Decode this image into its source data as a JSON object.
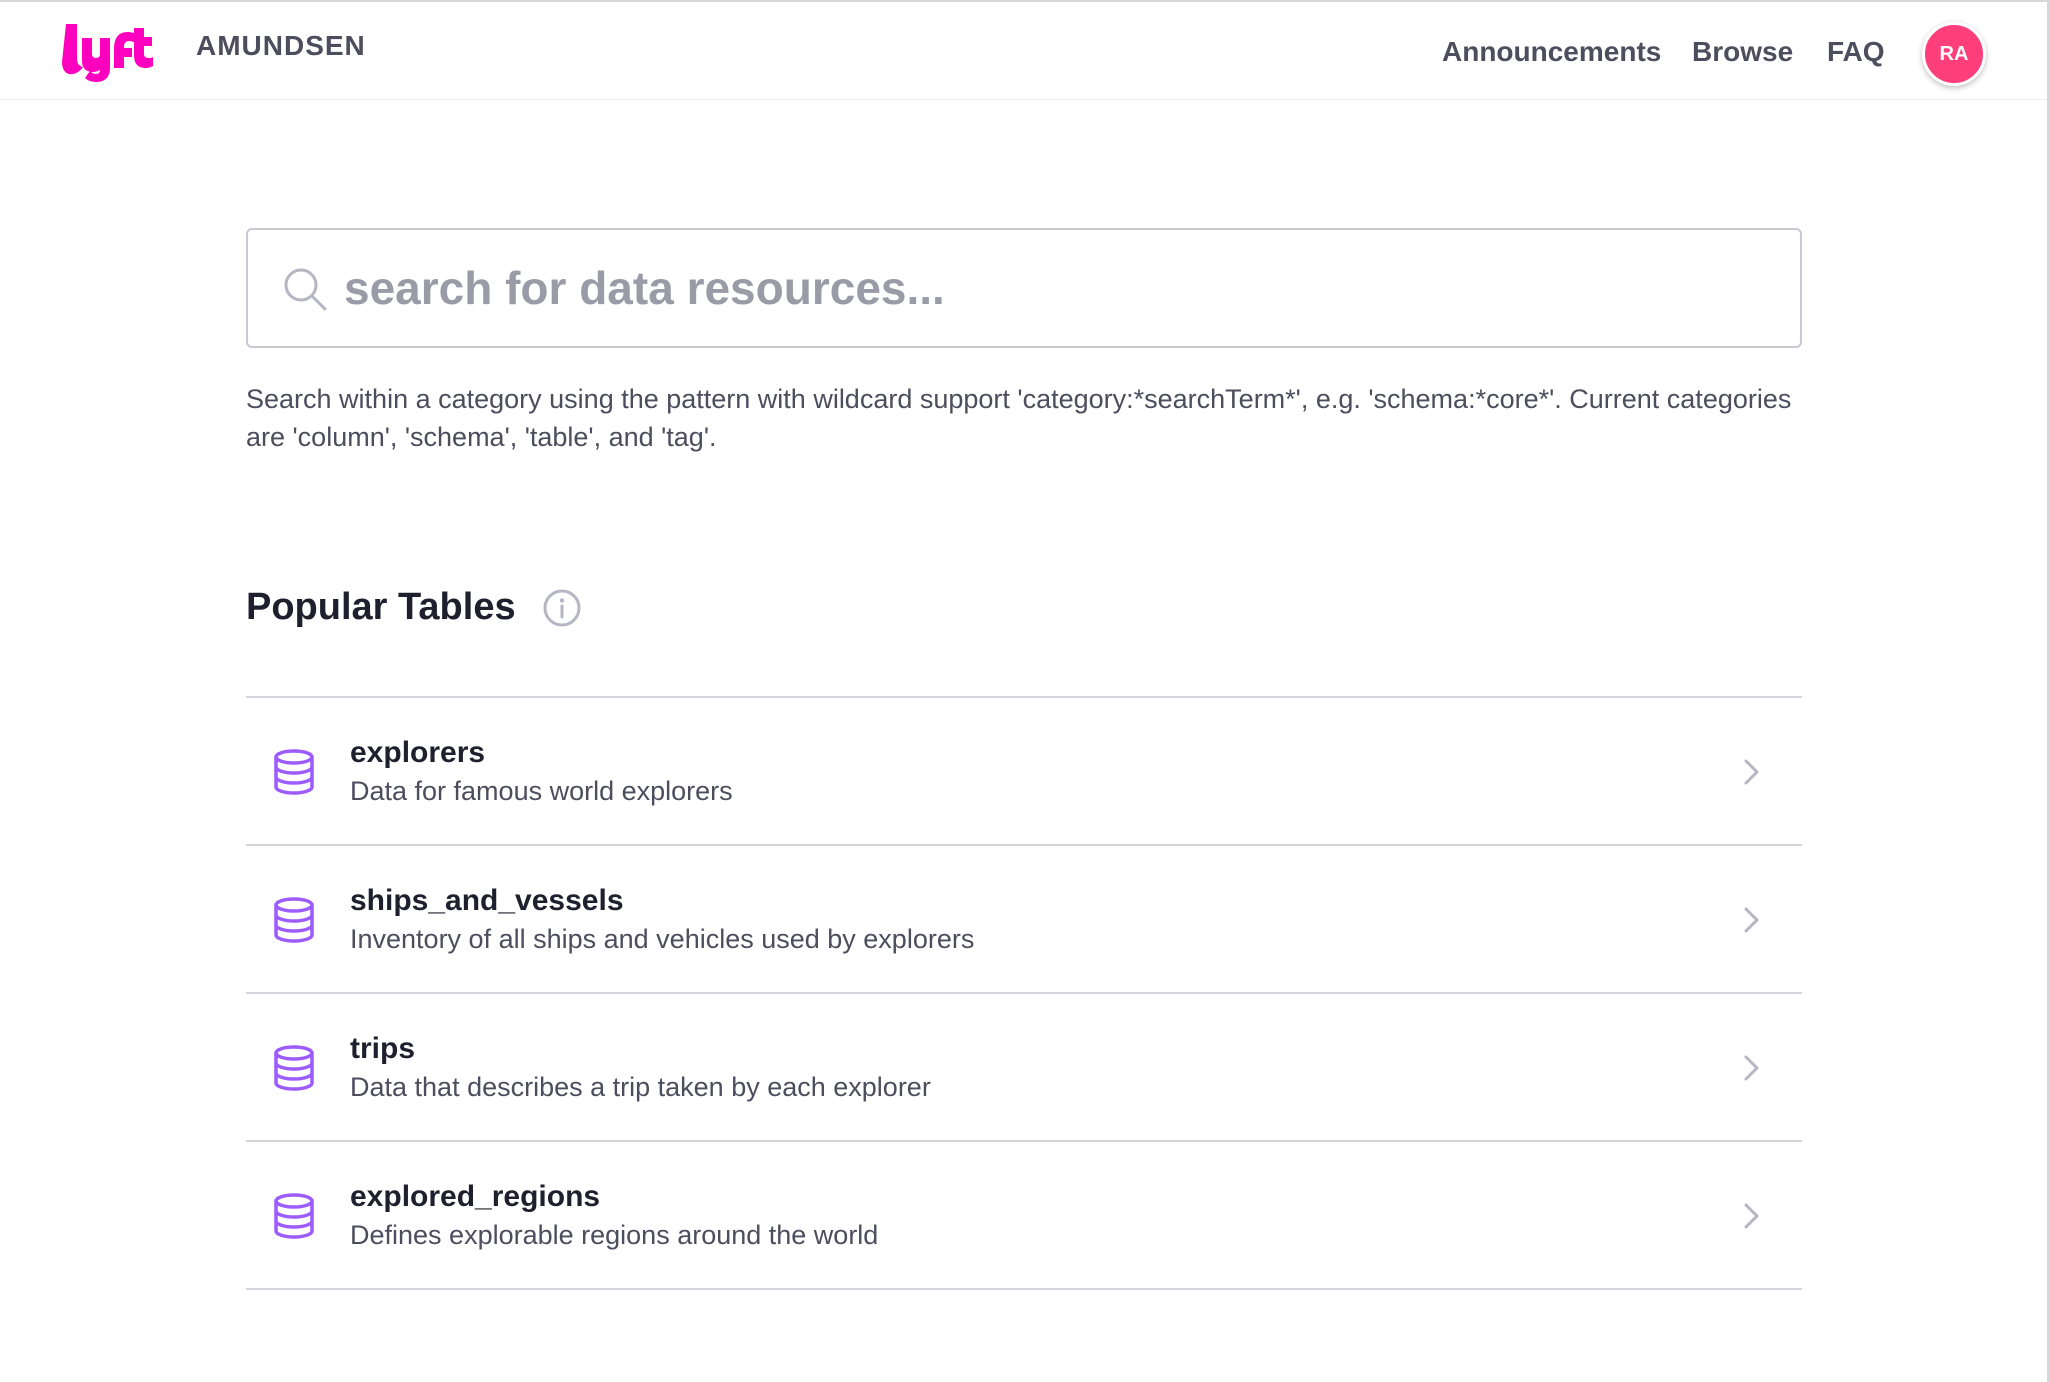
{
  "header": {
    "app_name": "AMUNDSEN",
    "logo": "lyft-logo",
    "nav": [
      {
        "label": "Announcements"
      },
      {
        "label": "Browse"
      },
      {
        "label": "FAQ"
      }
    ],
    "avatar": {
      "initials": "RA",
      "color": "#ff3e7c"
    }
  },
  "search": {
    "placeholder": "search for data resources...",
    "value": "",
    "icon": "search-icon",
    "help_text": "Search within a category using the pattern with wildcard support 'category:*searchTerm*', e.g. 'schema:*core*'. Current categories are 'column', 'schema', 'table', and 'tag'."
  },
  "popular_tables": {
    "title": "Popular Tables",
    "info_icon": "info-icon",
    "items": [
      {
        "name": "explorers",
        "description": "Data for famous world explorers",
        "icon": "database-icon"
      },
      {
        "name": "ships_and_vessels",
        "description": "Inventory of all ships and vehicles used by explorers",
        "icon": "database-icon"
      },
      {
        "name": "trips",
        "description": "Data that describes a trip taken by each explorer",
        "icon": "database-icon"
      },
      {
        "name": "explored_regions",
        "description": "Defines explorable regions around the world",
        "icon": "database-icon"
      }
    ]
  },
  "colors": {
    "brand": "#ff00bf",
    "accent_icon": "#9c5cff",
    "avatar": "#ff3e7c",
    "text_primary": "#1f1f2e",
    "text_secondary": "#4d4d5e"
  }
}
